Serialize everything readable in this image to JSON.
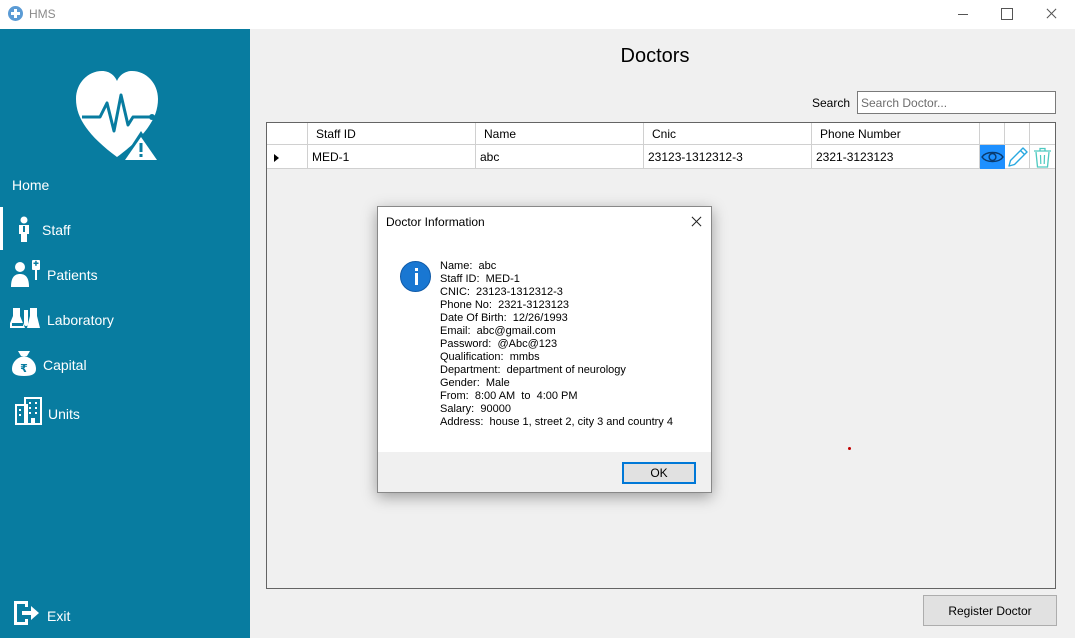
{
  "window": {
    "title": "HMS"
  },
  "sidebar": {
    "items": [
      {
        "label": "Home"
      },
      {
        "label": "Staff"
      },
      {
        "label": "Patients"
      },
      {
        "label": "Laboratory"
      },
      {
        "label": "Capital"
      },
      {
        "label": "Units"
      }
    ],
    "exit_label": "Exit"
  },
  "main": {
    "title": "Doctors",
    "search": {
      "label": "Search",
      "placeholder": "Search Doctor..."
    },
    "table": {
      "columns": [
        "Staff ID",
        "Name",
        "Cnic",
        "Phone Number"
      ],
      "rows": [
        {
          "staff_id": "MED-1",
          "name": "abc",
          "cnic": "23123-1312312-3",
          "phone": "2321-3123123"
        }
      ]
    },
    "register_button": "Register Doctor"
  },
  "dialog": {
    "title": "Doctor Information",
    "lines": [
      "Name:  abc",
      "Staff ID:  MED-1",
      "CNIC:  23123-1312312-3",
      "Phone No:  2321-3123123",
      "Date Of Birth:  12/26/1993",
      "Email:  abc@gmail.com",
      "Password:  @Abc@123",
      "Qualification:  mmbs",
      "Department:  department of neurology",
      "Gender:  Male",
      "From:  8:00 AM  to  4:00 PM",
      "Salary:  90000",
      "Address:  house 1, street 2, city 3 and country 4"
    ],
    "ok_label": "OK"
  },
  "colors": {
    "sidebar": "#087ca0",
    "accent": "#0078d7",
    "view_button": "#1e90ff"
  },
  "icons": [
    "heart-pulse-logo-icon",
    "staff-person-icon",
    "patients-icon",
    "laboratory-flask-icon",
    "capital-rupee-icon",
    "units-building-icon",
    "exit-icon",
    "view-eye-icon",
    "edit-pencil-icon",
    "delete-trash-icon",
    "info-icon"
  ]
}
